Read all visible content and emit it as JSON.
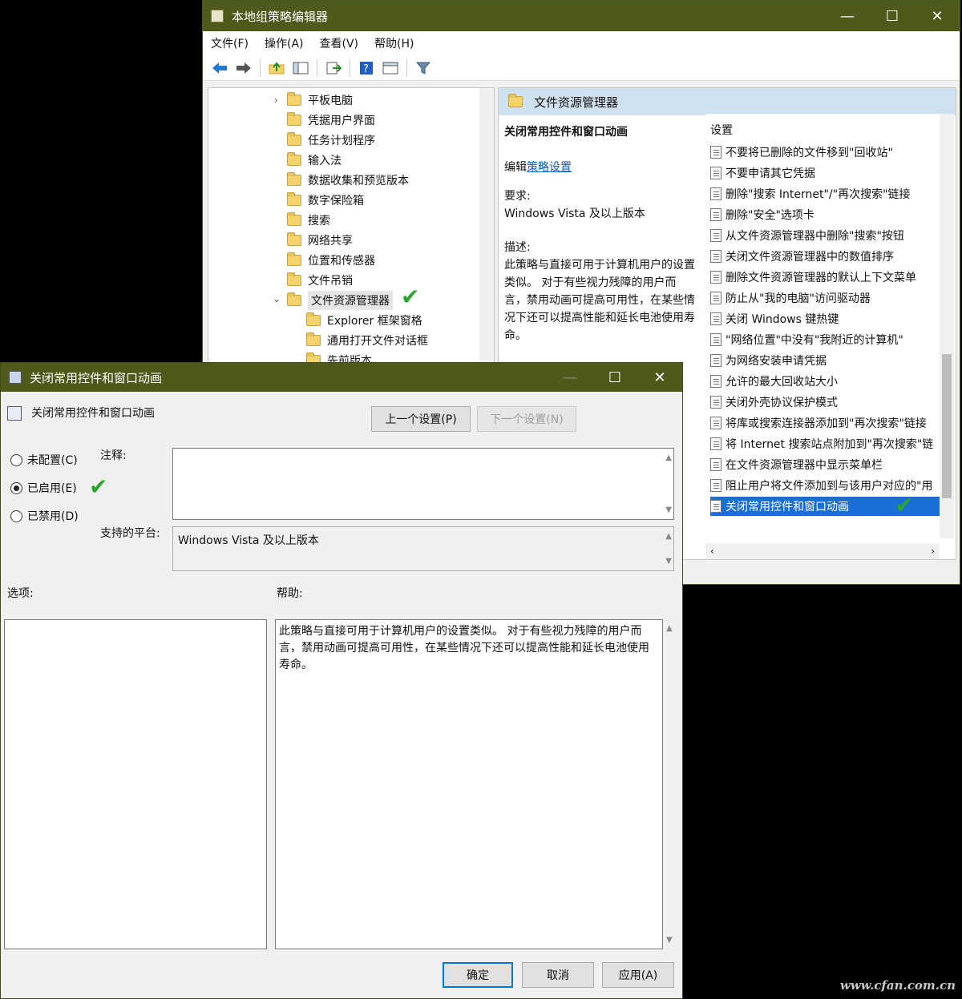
{
  "main_window": {
    "title": "本地组策略编辑器",
    "controls": {
      "minimize": "—",
      "maximize": "☐",
      "close": "✕"
    },
    "menu": [
      "文件(F)",
      "操作(A)",
      "查看(V)",
      "帮助(H)"
    ],
    "toolbar_icons": [
      "back-icon",
      "forward-icon",
      "up-folder-icon",
      "show-hide-tree-icon",
      "export-list-icon",
      "help-icon",
      "view-icon",
      "filter-icon"
    ],
    "tree": {
      "items": [
        {
          "label": "平板电脑",
          "expander": "›"
        },
        {
          "label": "凭据用户界面"
        },
        {
          "label": "任务计划程序"
        },
        {
          "label": "输入法"
        },
        {
          "label": "数据收集和预览版本"
        },
        {
          "label": "数字保险箱"
        },
        {
          "label": "搜索"
        },
        {
          "label": "网络共享"
        },
        {
          "label": "位置和传感器"
        },
        {
          "label": "文件吊销"
        },
        {
          "label": "文件资源管理器",
          "expander": "⌄",
          "selected": true
        },
        {
          "label": "Explorer 框架窗格",
          "child": true
        },
        {
          "label": "通用打开文件对话框",
          "child": true
        },
        {
          "label": "先前版本",
          "child": true
        }
      ]
    },
    "detail": {
      "header": "文件资源管理器",
      "policy_title": "关闭常用控件和窗口动画",
      "edit_prefix": "编辑",
      "edit_link": "策略设置",
      "requirements_label": "要求:",
      "requirements_value": "Windows Vista 及以上版本",
      "description_label": "描述:",
      "description_text": "此策略与直接可用于计算机用户的设置类似。 对于有些视力残障的用户而言，禁用动画可提高可用性，在某些情况下还可以提高性能和延长电池使用寿命。",
      "settings_header": "设置",
      "settings": [
        "不要将已删除的文件移到\"回收站\"",
        "不要申请其它凭据",
        "删除\"搜索 Internet\"/\"再次搜索\"链接",
        "删除\"安全\"选项卡",
        "从文件资源管理器中删除\"搜索\"按钮",
        "关闭文件资源管理器中的数值排序",
        "删除文件资源管理器的默认上下文菜单",
        "防止从\"我的电脑\"访问驱动器",
        "关闭 Windows 键热键",
        "\"网络位置\"中没有\"我附近的计算机\"",
        "为网络安装申请凭据",
        "允许的最大回收站大小",
        "关闭外壳协议保护模式",
        "将库或搜索连接器添加到\"再次搜索\"链接",
        "将 Internet 搜索站点附加到\"再次搜索\"链",
        "在文件资源管理器中显示菜单栏",
        "阻止用户将文件添加到与该用户对应的\"用",
        "关闭常用控件和窗口动画"
      ],
      "scroll_left": "‹",
      "scroll_right": "›"
    }
  },
  "dialog": {
    "title": "关闭常用控件和窗口动画",
    "controls": {
      "minimize": "—",
      "maximize": "☐",
      "close": "✕"
    },
    "policy_name": "关闭常用控件和窗口动画",
    "prev_button": "上一个设置(P)",
    "next_button": "下一个设置(N)",
    "radio_not_configured": "未配置(C)",
    "radio_enabled": "已启用(E)",
    "radio_disabled": "已禁用(D)",
    "comment_label": "注释:",
    "platform_label": "支持的平台:",
    "platform_value": "Windows Vista 及以上版本",
    "options_label": "选项:",
    "help_label": "帮助:",
    "help_text": "此策略与直接可用于计算机用户的设置类似。 对于有些视力残障的用户而言，禁用动画可提高可用性，在某些情况下还可以提高性能和延长电池使用寿命。",
    "ok_button": "确定",
    "cancel_button": "取消",
    "apply_button": "应用(A)"
  },
  "annotation_mark": "✔",
  "watermark": "www.cfan.com.cn"
}
